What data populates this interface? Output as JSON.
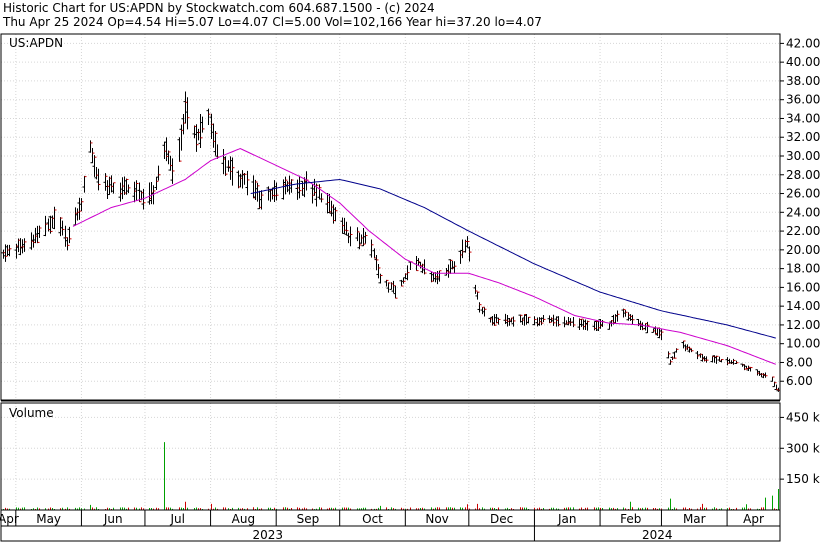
{
  "header": {
    "line1": "Historic Chart for US:APDN by Stockwatch.com 604.687.1500 - (c) 2024",
    "line2": "Thu Apr 25 2024  Op=4.54  Hi=5.07  Lo=4.07  Cl=5.00  Vol=102,166  Year hi=37.20  lo=4.07"
  },
  "chart_data": [
    {
      "type": "candlestick",
      "label": "US:APDN",
      "ylim": [
        4,
        43
      ],
      "y_ticks": [
        "6.00",
        "8.00",
        "10.00",
        "12.00",
        "14.00",
        "16.00",
        "18.00",
        "20.00",
        "22.00",
        "24.00",
        "26.00",
        "28.00",
        "30.00",
        "32.00",
        "34.00",
        "36.00",
        "38.00",
        "40.00",
        "42.00"
      ],
      "grid": true,
      "x_months": [
        "Apr",
        "May",
        "Jun",
        "Jul",
        "Aug",
        "Sep",
        "Oct",
        "Nov",
        "Dec",
        "Jan",
        "Feb",
        "Mar",
        "Apr"
      ],
      "x_years": [
        "2023",
        "2024"
      ],
      "price_keypoints": [
        [
          "2023-04-25",
          19.6
        ],
        [
          "2023-05-05",
          20.5
        ],
        [
          "2023-05-15",
          22.5
        ],
        [
          "2023-05-20",
          23.5
        ],
        [
          "2023-05-25",
          21.0
        ],
        [
          "2023-06-01",
          25.0
        ],
        [
          "2023-06-05",
          31.0
        ],
        [
          "2023-06-08",
          28.0
        ],
        [
          "2023-06-15",
          26.5
        ],
        [
          "2023-06-25",
          26.5
        ],
        [
          "2023-07-01",
          25.5
        ],
        [
          "2023-07-05",
          26.0
        ],
        [
          "2023-07-10",
          31.0
        ],
        [
          "2023-07-15",
          28.0
        ],
        [
          "2023-07-20",
          35.0
        ],
        [
          "2023-07-25",
          32.0
        ],
        [
          "2023-07-31",
          34.0
        ],
        [
          "2023-08-05",
          30.0
        ],
        [
          "2023-08-12",
          28.0
        ],
        [
          "2023-08-20",
          27.0
        ],
        [
          "2023-08-25",
          25.5
        ],
        [
          "2023-09-05",
          26.5
        ],
        [
          "2023-09-15",
          27.0
        ],
        [
          "2023-09-25",
          25.0
        ],
        [
          "2023-10-05",
          21.5
        ],
        [
          "2023-10-15",
          21.0
        ],
        [
          "2023-10-20",
          17.0
        ],
        [
          "2023-10-28",
          15.5
        ],
        [
          "2023-11-05",
          19.0
        ],
        [
          "2023-11-15",
          17.0
        ],
        [
          "2023-11-25",
          18.5
        ],
        [
          "2023-11-30",
          21.0
        ],
        [
          "2023-12-03",
          17.0
        ],
        [
          "2023-12-06",
          14.0
        ],
        [
          "2023-12-10",
          12.5
        ],
        [
          "2023-12-20",
          12.5
        ],
        [
          "2024-01-10",
          12.5
        ],
        [
          "2024-01-25",
          12.0
        ],
        [
          "2024-02-05",
          12.0
        ],
        [
          "2024-02-12",
          13.5
        ],
        [
          "2024-02-20",
          12.0
        ],
        [
          "2024-03-01",
          11.0
        ],
        [
          "2024-03-05",
          8.0
        ],
        [
          "2024-03-10",
          10.0
        ],
        [
          "2024-03-20",
          8.5
        ],
        [
          "2024-04-05",
          8.0
        ],
        [
          "2024-04-15",
          7.0
        ],
        [
          "2024-04-22",
          6.2
        ],
        [
          "2024-04-25",
          5.0
        ]
      ],
      "moving_averages": [
        {
          "color": "#cc00cc",
          "keypoints": [
            [
              "2023-05-28",
              22.5
            ],
            [
              "2023-06-15",
              24.5
            ],
            [
              "2023-07-01",
              25.5
            ],
            [
              "2023-07-20",
              27.5
            ],
            [
              "2023-08-01",
              29.5
            ],
            [
              "2023-08-15",
              30.8
            ],
            [
              "2023-09-01",
              29.0
            ],
            [
              "2023-09-15",
              27.5
            ],
            [
              "2023-10-01",
              25.0
            ],
            [
              "2023-10-15",
              22.0
            ],
            [
              "2023-11-01",
              19.0
            ],
            [
              "2023-11-15",
              17.5
            ],
            [
              "2023-12-01",
              17.5
            ],
            [
              "2023-12-15",
              16.5
            ],
            [
              "2024-01-01",
              15.0
            ],
            [
              "2024-01-20",
              13.0
            ],
            [
              "2024-02-05",
              12.2
            ],
            [
              "2024-02-20",
              12.0
            ],
            [
              "2024-03-10",
              11.2
            ],
            [
              "2024-04-01",
              9.8
            ],
            [
              "2024-04-24",
              7.8
            ]
          ]
        },
        {
          "color": "#00008b",
          "keypoints": [
            [
              "2023-08-20",
              26.0
            ],
            [
              "2023-09-10",
              27.0
            ],
            [
              "2023-10-01",
              27.5
            ],
            [
              "2023-10-20",
              26.5
            ],
            [
              "2023-11-10",
              24.5
            ],
            [
              "2023-12-01",
              22.0
            ],
            [
              "2024-01-01",
              18.5
            ],
            [
              "2024-02-01",
              15.5
            ],
            [
              "2024-03-01",
              13.5
            ],
            [
              "2024-04-01",
              12.0
            ],
            [
              "2024-04-24",
              10.6
            ]
          ]
        }
      ]
    },
    {
      "type": "bar",
      "label": "Volume",
      "y_ticks": [
        "150 k",
        "300 k",
        "450 k"
      ],
      "ylim": [
        0,
        520000
      ],
      "bar_color": "#00a000",
      "baseline_volume": 9000,
      "spikes": [
        [
          "2023-07-10",
          330000
        ],
        [
          "2023-06-05",
          25000
        ],
        [
          "2023-07-20",
          40000
        ],
        [
          "2023-08-01",
          30000
        ],
        [
          "2023-10-20",
          20000
        ],
        [
          "2023-11-30",
          28000
        ],
        [
          "2023-12-05",
          30000
        ],
        [
          "2024-02-10",
          25000
        ],
        [
          "2024-02-15",
          40000
        ],
        [
          "2024-03-05",
          55000
        ],
        [
          "2024-03-20",
          30000
        ],
        [
          "2024-04-10",
          28000
        ],
        [
          "2024-04-19",
          60000
        ],
        [
          "2024-04-22",
          70000
        ],
        [
          "2024-04-25",
          102166
        ]
      ]
    }
  ]
}
